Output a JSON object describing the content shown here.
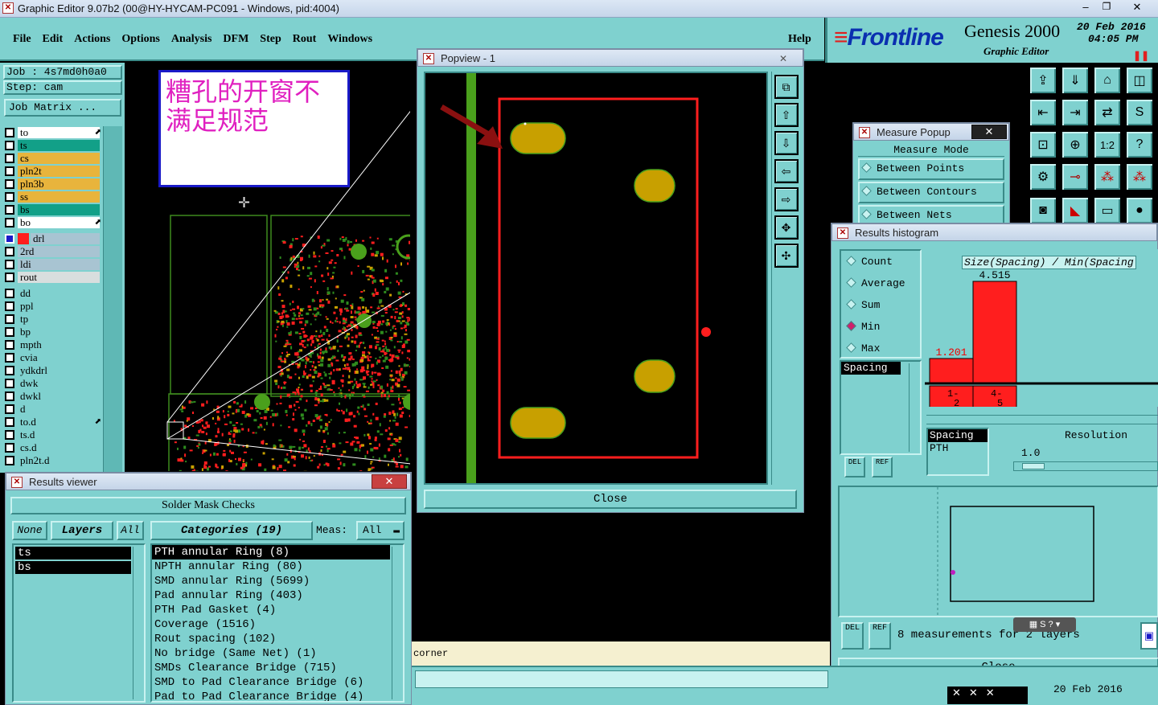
{
  "app": {
    "title": "Graphic Editor 9.07b2 (00@HY-HYCAM-PC091 - Windows, pid:4004)"
  },
  "menu": [
    "File",
    "Edit",
    "Actions",
    "Options",
    "Analysis",
    "DFM",
    "Step",
    "Rout",
    "Windows"
  ],
  "help_label": "Help",
  "brand": {
    "logo": "Frontline",
    "product": "Genesis 2000",
    "subtitle": "Graphic Editor",
    "date": "20 Feb 2016",
    "time": "04:05 PM"
  },
  "job": {
    "job_line": "Job : 4s7md0h0a0",
    "step_line": "Step: cam",
    "matrix_button": "Job Matrix ..."
  },
  "layers": [
    {
      "name": "to",
      "color": "#ffffff",
      "arrow": true
    },
    {
      "name": "ts",
      "color": "#12a088"
    },
    {
      "name": "cs",
      "color": "#e8b43c"
    },
    {
      "name": "pln2t",
      "color": "#e8b43c"
    },
    {
      "name": "pln3b",
      "color": "#e8b43c"
    },
    {
      "name": "ss",
      "color": "#e8b43c"
    },
    {
      "name": "bs",
      "color": "#12a088"
    },
    {
      "name": "bo",
      "color": "#ffffff",
      "arrow": true
    },
    {
      "name": "drl",
      "color": "#a8c4d2",
      "sel": true
    },
    {
      "name": "2rd",
      "color": "#a8c4d2"
    },
    {
      "name": "ldi",
      "color": "#a8c4d2"
    },
    {
      "name": "rout",
      "color": "#d8dede"
    },
    {
      "name": "dd",
      "color": "#7fd1cf"
    },
    {
      "name": "ppl",
      "color": "#7fd1cf"
    },
    {
      "name": "tp",
      "color": "#7fd1cf"
    },
    {
      "name": "bp",
      "color": "#7fd1cf"
    },
    {
      "name": "mpth",
      "color": "#7fd1cf"
    },
    {
      "name": "cvia",
      "color": "#7fd1cf"
    },
    {
      "name": "ydkdrl",
      "color": "#7fd1cf"
    },
    {
      "name": "dwk",
      "color": "#7fd1cf"
    },
    {
      "name": "dwkl",
      "color": "#7fd1cf"
    },
    {
      "name": "d",
      "color": "#7fd1cf"
    },
    {
      "name": "to.d",
      "color": "#7fd1cf",
      "arrow": true
    },
    {
      "name": "ts.d",
      "color": "#7fd1cf"
    },
    {
      "name": "cs.d",
      "color": "#7fd1cf"
    },
    {
      "name": "pln2t.d",
      "color": "#7fd1cf"
    }
  ],
  "note": {
    "text": "糟孔的开窗不满足规范"
  },
  "popview": {
    "title": "Popview - 1",
    "close": "Close"
  },
  "measure": {
    "title": "Measure Popup",
    "header": "Measure Mode",
    "options": [
      "Between Points",
      "Between Contours",
      "Between Nets"
    ]
  },
  "histogram": {
    "title": "Results histogram",
    "radios": [
      "Count",
      "Average",
      "Sum",
      "Min",
      "Max"
    ],
    "selected": "Min",
    "list_item": "Spacing",
    "chart_label": "Size(Spacing) / Min(Spacing",
    "bars": [
      {
        "value": "1.201",
        "range_top": "1-",
        "range_bottom": "2"
      },
      {
        "value": "4.515",
        "range_top": "4-",
        "range_bottom": "5"
      }
    ],
    "bar_values": [
      1.201,
      4.515
    ],
    "spacing_list": [
      "Spacing",
      "PTH"
    ],
    "resolution_label": "Resolution",
    "resolution_value": "1.0",
    "del": "DEL",
    "ref": "REF",
    "status": "8 measurements for 2 layers",
    "close": "Close"
  },
  "results_viewer": {
    "title": "Results viewer",
    "header": "Solder Mask Checks",
    "btn_none": "None",
    "btn_layers": "Layers",
    "btn_all": "All",
    "categories_label": "Categories (19)",
    "meas_label": "Meas:",
    "meas_value": "All",
    "layer_list": [
      "ts",
      "bs"
    ],
    "categories": [
      "PTH annular Ring (8)",
      "NPTH annular Ring (80)",
      "SMD annular Ring (5699)",
      "Pad annular Ring (403)",
      "PTH Pad Gasket (4)",
      "Coverage (1516)",
      "Rout spacing (102)",
      "No bridge (Same Net) (1)",
      "SMDs Clearance Bridge (715)",
      "SMD to Pad Clearance Bridge (6)",
      "Pad to Pad Clearance Bridge (4)"
    ]
  },
  "status": {
    "corner_text": "corner",
    "bottom_date": "20 Feb 2016"
  },
  "colors": {
    "teal": "#7fd1cf",
    "highlight_red": "#ff1e1e",
    "pad_gold": "#c8a000",
    "trace_green": "#4aa01c"
  }
}
